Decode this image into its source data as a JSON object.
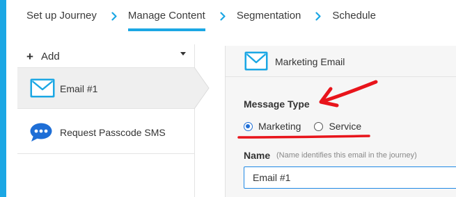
{
  "stepper": {
    "steps": [
      {
        "label": "Set up Journey"
      },
      {
        "label": "Manage Content"
      },
      {
        "label": "Segmentation"
      },
      {
        "label": "Schedule"
      }
    ],
    "active_step": "Manage Content"
  },
  "left_panel": {
    "add_label": "Add",
    "add_icon": "plus-icon",
    "dropdown_icon": "caret-down-icon",
    "items": [
      {
        "label": "Email #1",
        "icon": "envelope-icon",
        "selected": true
      },
      {
        "label": "Request Passcode SMS",
        "icon": "chat-bubble-icon",
        "selected": false
      }
    ]
  },
  "editor": {
    "header_title": "Marketing Email",
    "header_icon": "envelope-icon",
    "message_type_label": "Message Type",
    "message_type_options": [
      "Marketing",
      "Service"
    ],
    "message_type_selected": "Marketing",
    "name_label": "Name",
    "name_hint": "(Name identifies this email in the journey)",
    "name_value": "Email #1"
  },
  "colors": {
    "accent": "#1ba7e4",
    "radio_selected": "#1e6ed6",
    "annotation": "#e8141b",
    "selected_item_bg": "#efefef",
    "panel_bg": "#f6f6f6"
  }
}
